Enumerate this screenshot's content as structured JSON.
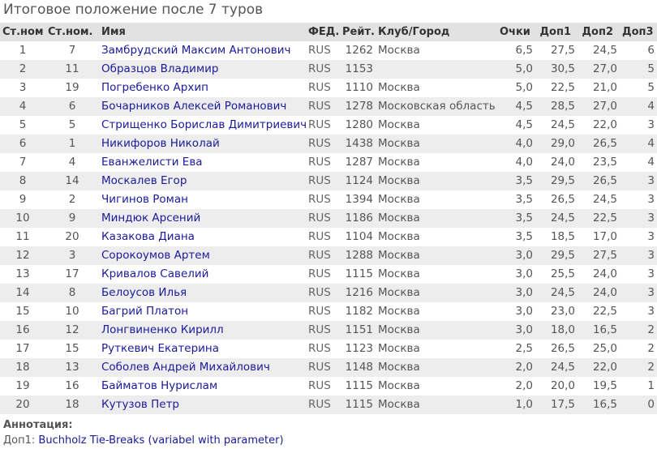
{
  "title": "Итоговое положение после 7 туров",
  "columns": {
    "start_no": "Ст.ном",
    "start_no2": "Ст.ном.",
    "name": "Имя",
    "fed": "ФЕД.",
    "rating": "Рейт.",
    "club": "Клуб/Город",
    "points": "Очки",
    "tb1": "Доп1",
    "tb2": "Доп2",
    "tb3": "Доп3"
  },
  "rows": [
    {
      "rank": "1",
      "start": "7",
      "name": "Замбрудский Максим Антонович",
      "fed": "RUS",
      "rating": "1262",
      "club": "Москва",
      "points": "6,5",
      "tb1": "27,5",
      "tb2": "24,5",
      "tb3": "6"
    },
    {
      "rank": "2",
      "start": "11",
      "name": "Образцов Владимир",
      "fed": "RUS",
      "rating": "1153",
      "club": "",
      "points": "5,0",
      "tb1": "30,5",
      "tb2": "27,0",
      "tb3": "5"
    },
    {
      "rank": "3",
      "start": "19",
      "name": "Погребенко Архип",
      "fed": "RUS",
      "rating": "1110",
      "club": "Москва",
      "points": "5,0",
      "tb1": "22,5",
      "tb2": "21,0",
      "tb3": "5"
    },
    {
      "rank": "4",
      "start": "6",
      "name": "Бочарников Алексей Романович",
      "fed": "RUS",
      "rating": "1278",
      "club": "Московская область",
      "points": "4,5",
      "tb1": "28,5",
      "tb2": "27,0",
      "tb3": "4"
    },
    {
      "rank": "5",
      "start": "5",
      "name": "Стрищенко Борислав Димитриевич",
      "fed": "RUS",
      "rating": "1280",
      "club": "Москва",
      "points": "4,5",
      "tb1": "24,5",
      "tb2": "22,0",
      "tb3": "3"
    },
    {
      "rank": "6",
      "start": "1",
      "name": "Никифоров Николай",
      "fed": "RUS",
      "rating": "1438",
      "club": "Москва",
      "points": "4,0",
      "tb1": "29,0",
      "tb2": "26,5",
      "tb3": "4"
    },
    {
      "rank": "7",
      "start": "4",
      "name": "Еванжелисти Ева",
      "fed": "RUS",
      "rating": "1287",
      "club": "Москва",
      "points": "4,0",
      "tb1": "24,0",
      "tb2": "23,5",
      "tb3": "4"
    },
    {
      "rank": "8",
      "start": "14",
      "name": "Москалев Егор",
      "fed": "RUS",
      "rating": "1124",
      "club": "Москва",
      "points": "3,5",
      "tb1": "29,5",
      "tb2": "26,5",
      "tb3": "3"
    },
    {
      "rank": "9",
      "start": "2",
      "name": "Чигинов Роман",
      "fed": "RUS",
      "rating": "1394",
      "club": "Москва",
      "points": "3,5",
      "tb1": "26,5",
      "tb2": "24,5",
      "tb3": "3"
    },
    {
      "rank": "10",
      "start": "9",
      "name": "Миндюк Арсений",
      "fed": "RUS",
      "rating": "1186",
      "club": "Москва",
      "points": "3,5",
      "tb1": "24,5",
      "tb2": "22,5",
      "tb3": "3"
    },
    {
      "rank": "11",
      "start": "20",
      "name": "Казакова Диана",
      "fed": "RUS",
      "rating": "1104",
      "club": "Москва",
      "points": "3,5",
      "tb1": "18,5",
      "tb2": "17,0",
      "tb3": "3"
    },
    {
      "rank": "12",
      "start": "3",
      "name": "Сорокоумов Артем",
      "fed": "RUS",
      "rating": "1288",
      "club": "Москва",
      "points": "3,0",
      "tb1": "29,5",
      "tb2": "27,5",
      "tb3": "3"
    },
    {
      "rank": "13",
      "start": "17",
      "name": "Кривалов Савелий",
      "fed": "RUS",
      "rating": "1115",
      "club": "Москва",
      "points": "3,0",
      "tb1": "25,5",
      "tb2": "24,0",
      "tb3": "3"
    },
    {
      "rank": "14",
      "start": "8",
      "name": "Белоусов Илья",
      "fed": "RUS",
      "rating": "1216",
      "club": "Москва",
      "points": "3,0",
      "tb1": "24,5",
      "tb2": "24,0",
      "tb3": "3"
    },
    {
      "rank": "15",
      "start": "10",
      "name": "Багрий Платон",
      "fed": "RUS",
      "rating": "1182",
      "club": "Москва",
      "points": "3,0",
      "tb1": "23,0",
      "tb2": "22,5",
      "tb3": "3"
    },
    {
      "rank": "16",
      "start": "12",
      "name": "Лонгвиненко Кирилл",
      "fed": "RUS",
      "rating": "1151",
      "club": "Москва",
      "points": "3,0",
      "tb1": "18,0",
      "tb2": "16,5",
      "tb3": "2"
    },
    {
      "rank": "17",
      "start": "15",
      "name": "Руткевич Екатерина",
      "fed": "RUS",
      "rating": "1123",
      "club": "Москва",
      "points": "2,5",
      "tb1": "26,5",
      "tb2": "25,0",
      "tb3": "2"
    },
    {
      "rank": "18",
      "start": "13",
      "name": "Соболев Андрей Михайлович",
      "fed": "RUS",
      "rating": "1148",
      "club": "Москва",
      "points": "2,0",
      "tb1": "24,5",
      "tb2": "22,0",
      "tb3": "2"
    },
    {
      "rank": "19",
      "start": "16",
      "name": "Байматов Нурислам",
      "fed": "RUS",
      "rating": "1115",
      "club": "Москва",
      "points": "2,0",
      "tb1": "20,0",
      "tb2": "19,5",
      "tb3": "1"
    },
    {
      "rank": "20",
      "start": "18",
      "name": "Кутузов Петр",
      "fed": "RUS",
      "rating": "1115",
      "club": "Москва",
      "points": "1,0",
      "tb1": "17,5",
      "tb2": "16,5",
      "tb3": "0"
    }
  ],
  "annotation": {
    "title": "Аннотация:",
    "label": "Доп1:",
    "text": "Buchholz Tie-Breaks (variabel with parameter)"
  },
  "colors": {
    "header_bg": "#e2e2e2",
    "row_alt_bg": "#ededed",
    "link": "#1a1a9c",
    "text": "#555555"
  }
}
